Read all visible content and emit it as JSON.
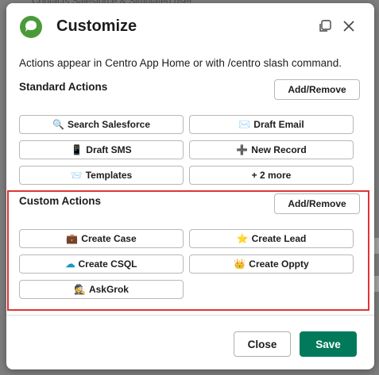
{
  "background": {
    "partial_text": "Contacts Salesforce & Simulated user"
  },
  "dialog": {
    "title": "Customize",
    "description": "Actions appear in Centro App Home or with /centro slash command."
  },
  "standard_actions": {
    "label": "Standard Actions",
    "add_remove": "Add/Remove",
    "items": [
      {
        "icon": "magnifier-icon",
        "glyph": "🔍",
        "label": "Search Salesforce"
      },
      {
        "icon": "envelope-icon",
        "glyph": "✉️",
        "label": "Draft Email"
      },
      {
        "icon": "phone-icon",
        "glyph": "📱",
        "label": "Draft SMS"
      },
      {
        "icon": "plus-icon",
        "glyph": "➕",
        "label": "New Record"
      },
      {
        "icon": "inbox-tray-icon",
        "glyph": "📨",
        "label": "Templates"
      },
      {
        "icon": "",
        "glyph": "",
        "label": "+ 2 more"
      }
    ]
  },
  "custom_actions": {
    "label": "Custom Actions",
    "add_remove": "Add/Remove",
    "highlight_color": "#e03434",
    "items": [
      {
        "icon": "briefcase-icon",
        "glyph": "💼",
        "label": "Create Case"
      },
      {
        "icon": "star-icon",
        "glyph": "⭐",
        "label": "Create Lead"
      },
      {
        "icon": "salesforce-cloud-icon",
        "glyph": "☁",
        "label": "Create CSQL"
      },
      {
        "icon": "crown-icon",
        "glyph": "👑",
        "label": "Create Oppty"
      },
      {
        "icon": "detective-icon",
        "glyph": "🕵",
        "label": "AskGrok"
      }
    ]
  },
  "footer": {
    "close_label": "Close",
    "save_label": "Save",
    "save_color": "#007a5a"
  }
}
